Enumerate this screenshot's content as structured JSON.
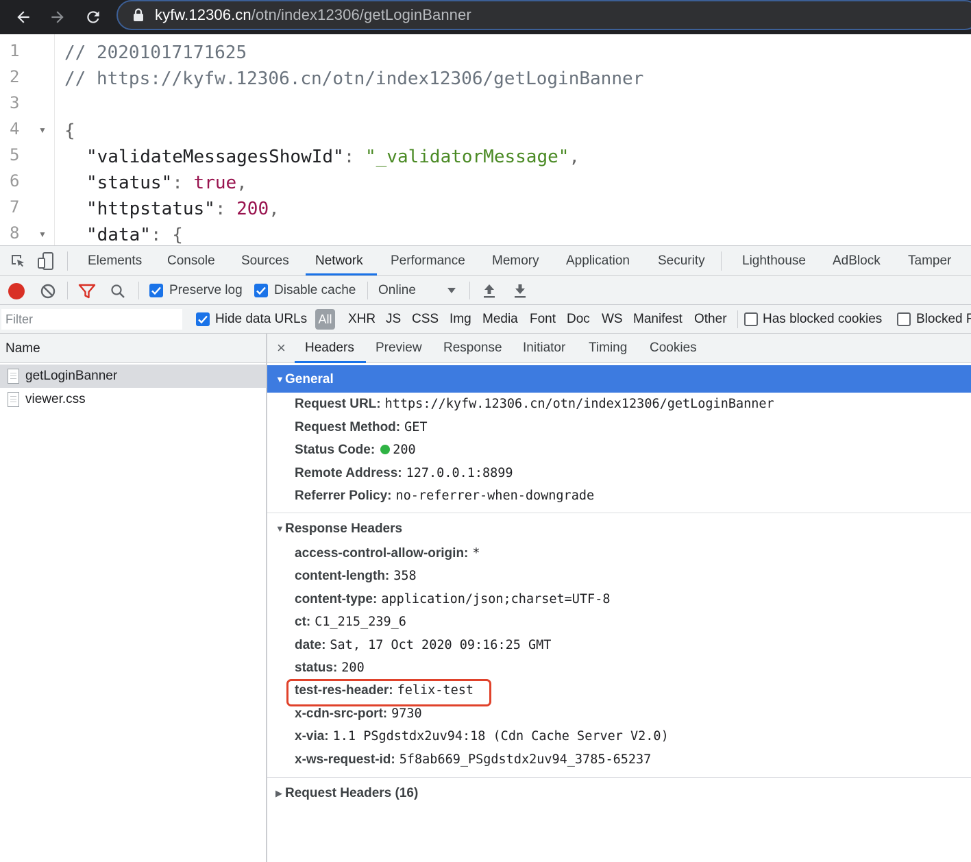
{
  "browser": {
    "url_host": "kyfw.12306.cn",
    "url_path": "/otn/index12306/getLoginBanner"
  },
  "viewer": {
    "lines": [
      {
        "n": "1",
        "fold": ""
      },
      {
        "n": "2",
        "fold": ""
      },
      {
        "n": "3",
        "fold": ""
      },
      {
        "n": "4",
        "fold": "▼"
      },
      {
        "n": "5",
        "fold": ""
      },
      {
        "n": "6",
        "fold": ""
      },
      {
        "n": "7",
        "fold": ""
      },
      {
        "n": "8",
        "fold": "▼"
      }
    ],
    "comment1": "// 20201017171625",
    "comment2": "// https://kyfw.12306.cn/otn/index12306/getLoginBanner",
    "open_brace": "{",
    "key1": "\"validateMessagesShowId\"",
    "val1": "\"_validatorMessage\"",
    "key2": "\"status\"",
    "val2": "true",
    "key3": "\"httpstatus\"",
    "val3": "200",
    "key4": "\"data\"",
    "val4": "{",
    "colon": ": ",
    "comma": ","
  },
  "devtools": {
    "tabs": [
      "Elements",
      "Console",
      "Sources",
      "Network",
      "Performance",
      "Memory",
      "Application",
      "Security",
      "Lighthouse",
      "AdBlock",
      "Tamper"
    ],
    "active_tab": "Network",
    "toolbar": {
      "preserve_log": "Preserve log",
      "preserve_log_checked": true,
      "disable_cache": "Disable cache",
      "disable_cache_checked": true,
      "throttle": "Online"
    },
    "filter": {
      "placeholder": "Filter",
      "hide_data_urls": "Hide data URLs",
      "hide_data_urls_checked": true,
      "types": [
        "All",
        "XHR",
        "JS",
        "CSS",
        "Img",
        "Media",
        "Font",
        "Doc",
        "WS",
        "Manifest",
        "Other"
      ],
      "has_blocked_cookies": "Has blocked cookies",
      "blocked": "Blocked R"
    },
    "request_list": {
      "header": "Name",
      "items": [
        "getLoginBanner",
        "viewer.css"
      ],
      "selected": "getLoginBanner"
    },
    "details": {
      "close": "×",
      "tabs": [
        "Headers",
        "Preview",
        "Response",
        "Initiator",
        "Timing",
        "Cookies"
      ],
      "active_tab": "Headers",
      "general": {
        "title": "General",
        "rows": [
          {
            "key": "Request URL:",
            "value": "https://kyfw.12306.cn/otn/index12306/getLoginBanner"
          },
          {
            "key": "Request Method:",
            "value": "GET"
          },
          {
            "key": "Status Code:",
            "value": "200"
          },
          {
            "key": "Remote Address:",
            "value": "127.0.0.1:8899"
          },
          {
            "key": "Referrer Policy:",
            "value": "no-referrer-when-downgrade"
          }
        ]
      },
      "response_headers": {
        "title": "Response Headers",
        "rows": [
          {
            "key": "access-control-allow-origin:",
            "value": "*"
          },
          {
            "key": "content-length:",
            "value": "358"
          },
          {
            "key": "content-type:",
            "value": "application/json;charset=UTF-8"
          },
          {
            "key": "ct:",
            "value": "C1_215_239_6"
          },
          {
            "key": "date:",
            "value": "Sat, 17 Oct 2020 09:16:25 GMT"
          },
          {
            "key": "status:",
            "value": "200"
          },
          {
            "key": "test-res-header:",
            "value": "felix-test"
          },
          {
            "key": "x-cdn-src-port:",
            "value": "9730"
          },
          {
            "key": "x-via:",
            "value": "1.1 PSgdstdx2uv94:18 (Cdn Cache Server V2.0)"
          },
          {
            "key": "x-ws-request-id:",
            "value": "5f8ab669_PSgdstdx2uv94_3785-65237"
          }
        ]
      },
      "request_headers": {
        "title": "Request Headers (16)"
      }
    }
  },
  "colors": {
    "accent": "#1a73e8",
    "general_header": "#3d7be0",
    "highlight": "#e0422b",
    "status_ok": "#2fb344"
  }
}
